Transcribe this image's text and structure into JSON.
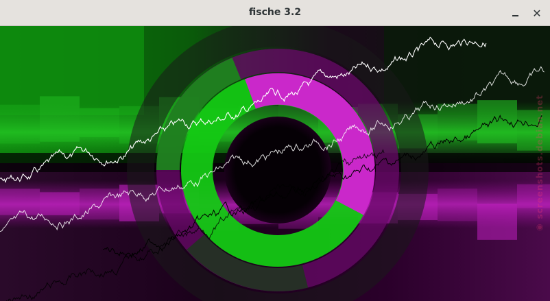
{
  "window": {
    "title": "fische 3.2",
    "minimize_glyph": "_",
    "close_glyph": "✕"
  },
  "visualization": {
    "colors": {
      "green": "#18d418",
      "magenta": "#e020e0",
      "dark_green": "#0a2a0a",
      "dark_magenta": "#2a0a2a",
      "wave_white": "#ffffff",
      "wave_black": "#000000"
    }
  },
  "watermark": {
    "text": "screenshots.debian.net",
    "icon": "camera-icon"
  }
}
